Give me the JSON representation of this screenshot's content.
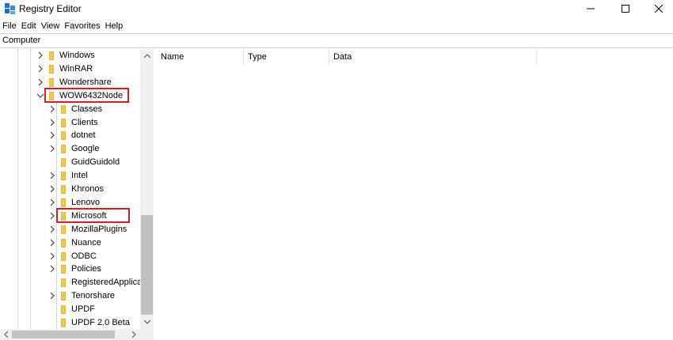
{
  "window": {
    "title": "Registry Editor"
  },
  "menu": [
    "File",
    "Edit",
    "View",
    "Favorites",
    "Help"
  ],
  "address": "Computer",
  "tree": {
    "items": [
      {
        "label": "Windows",
        "expander": "collapsed",
        "level": 1,
        "highlighted": false
      },
      {
        "label": "WinRAR",
        "expander": "collapsed",
        "level": 1,
        "highlighted": false
      },
      {
        "label": "Wondershare",
        "expander": "collapsed",
        "level": 1,
        "highlighted": false
      },
      {
        "label": "WOW6432Node",
        "expander": "expanded",
        "level": 1,
        "highlighted": true
      },
      {
        "label": "Classes",
        "expander": "collapsed",
        "level": 2,
        "highlighted": false
      },
      {
        "label": "Clients",
        "expander": "collapsed",
        "level": 2,
        "highlighted": false
      },
      {
        "label": "dotnet",
        "expander": "collapsed",
        "level": 2,
        "highlighted": false
      },
      {
        "label": "Google",
        "expander": "collapsed",
        "level": 2,
        "highlighted": false
      },
      {
        "label": "GuidGuidold",
        "expander": "none",
        "level": 2,
        "highlighted": false
      },
      {
        "label": "Intel",
        "expander": "collapsed",
        "level": 2,
        "highlighted": false
      },
      {
        "label": "Khronos",
        "expander": "collapsed",
        "level": 2,
        "highlighted": false
      },
      {
        "label": "Lenovo",
        "expander": "collapsed",
        "level": 2,
        "highlighted": false
      },
      {
        "label": "Microsoft",
        "expander": "collapsed",
        "level": 2,
        "highlighted": true
      },
      {
        "label": "MozillaPlugins",
        "expander": "collapsed",
        "level": 2,
        "highlighted": false
      },
      {
        "label": "Nuance",
        "expander": "collapsed",
        "level": 2,
        "highlighted": false
      },
      {
        "label": "ODBC",
        "expander": "collapsed",
        "level": 2,
        "highlighted": false
      },
      {
        "label": "Policies",
        "expander": "collapsed",
        "level": 2,
        "highlighted": false
      },
      {
        "label": "RegisteredApplica",
        "expander": "none",
        "level": 2,
        "highlighted": false
      },
      {
        "label": "Tenorshare",
        "expander": "collapsed",
        "level": 2,
        "highlighted": false
      },
      {
        "label": "UPDF",
        "expander": "none",
        "level": 2,
        "highlighted": false
      },
      {
        "label": "UPDF 2.0 Beta",
        "expander": "none",
        "level": 2,
        "highlighted": false
      }
    ]
  },
  "list": {
    "columns": [
      "Name",
      "Type",
      "Data"
    ]
  },
  "colors": {
    "highlight": "#d0202a",
    "folder": "#f2c94c"
  }
}
